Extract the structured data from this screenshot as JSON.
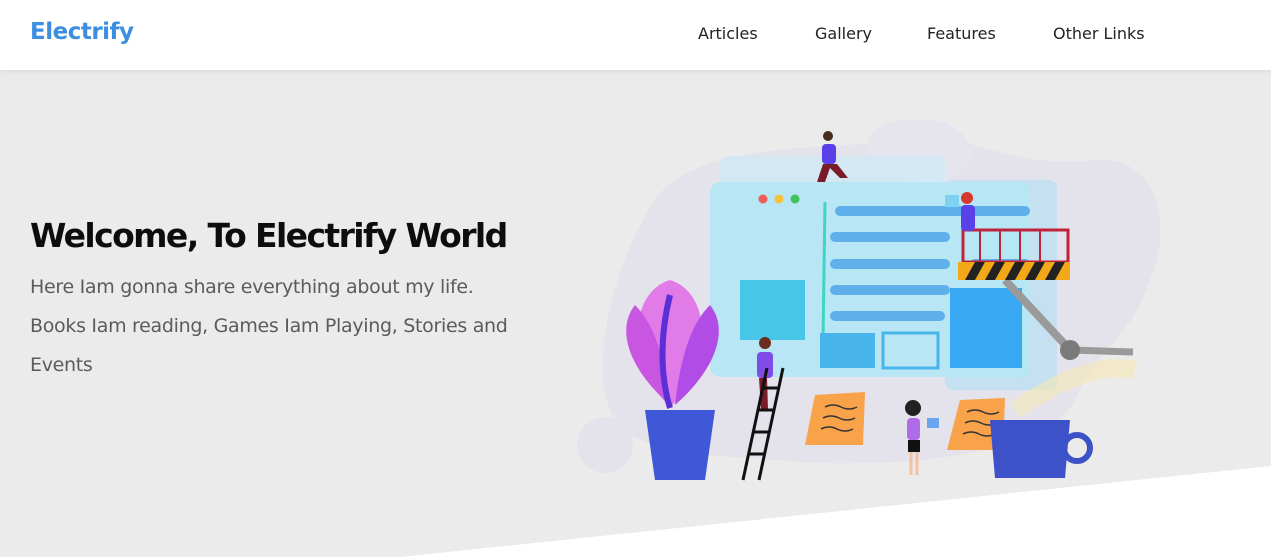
{
  "navbar": {
    "brand": "Electrify",
    "links": [
      {
        "label": "Articles"
      },
      {
        "label": "Gallery"
      },
      {
        "label": "Features"
      },
      {
        "label": "Other Links"
      }
    ]
  },
  "hero": {
    "title": "Welcome, To Electrify World",
    "line1": "Here Iam gonna share everything about my life.",
    "line2": "Books Iam reading, Games Iam Playing, Stories and",
    "line3": "Events",
    "illustration_icon": "web-design-team-illustration"
  },
  "colors": {
    "brand": "#3c8fe0",
    "background": "#ebebeb",
    "navbar_bg": "#ffffff",
    "heading": "#0d0d0d",
    "body_text": "#5b5b5b"
  }
}
